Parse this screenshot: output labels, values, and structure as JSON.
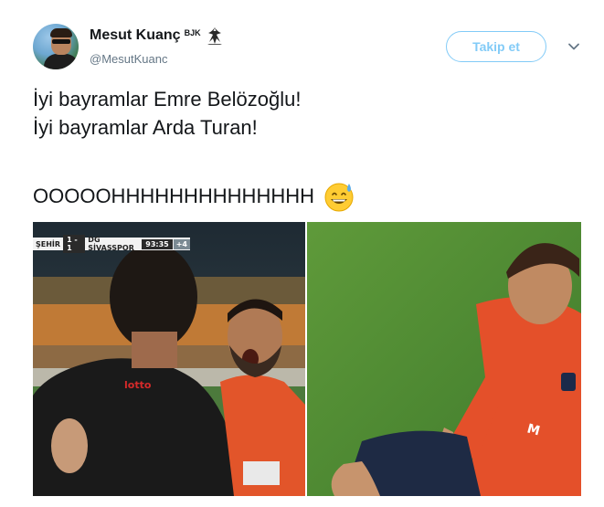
{
  "tweet": {
    "author_name": "Mesut Kuanç",
    "author_badge": "BJK",
    "author_handle": "@MesutKuanc",
    "follow_label": "Takip et",
    "text_line1": "İyi bayramlar Emre Belözoğlu!",
    "text_line2": "İyi bayramlar Arda Turan!",
    "text_line3": "OOOOOHHHHHHHHHHHHHH",
    "emoji": "grinning-face-with-sweat",
    "accent_color": "#1da1f2"
  },
  "media": {
    "left_image": {
      "description_icon": "football-celebration-photo",
      "scoreboard": {
        "home": "ŞEHİR",
        "score": "1 - 1",
        "away": "DG SİVASSPOR",
        "clock": "93:35",
        "extra": "+4"
      }
    },
    "right_image": {
      "description_icon": "football-player-sitting-photo"
    }
  }
}
